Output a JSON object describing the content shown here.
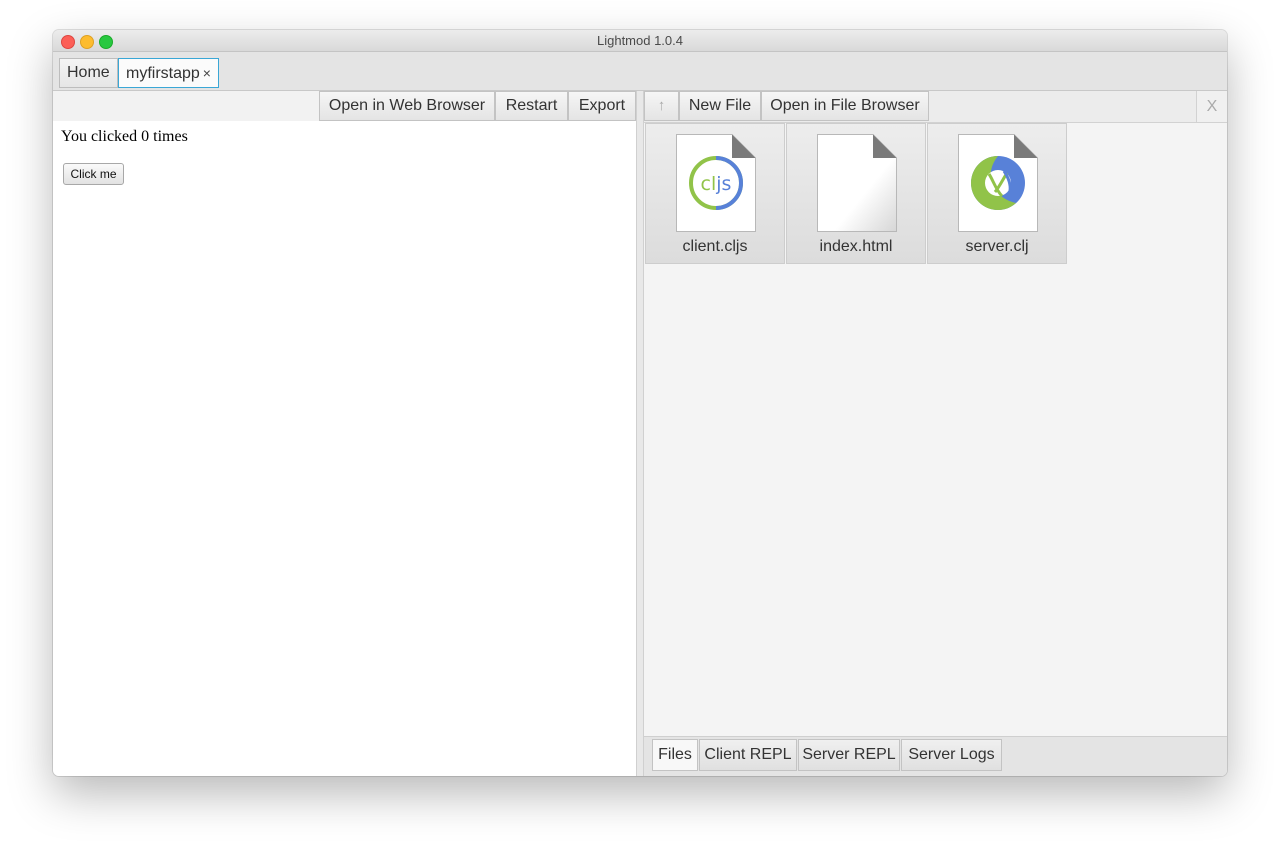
{
  "window": {
    "title": "Lightmod 1.0.4"
  },
  "tabs": [
    {
      "label": "Home"
    },
    {
      "label": "myfirstapp",
      "close": "×"
    }
  ],
  "left_toolbar": {
    "open_web_label": "Open in Web Browser",
    "restart_label": "Restart",
    "export_label": "Export"
  },
  "webview": {
    "status_text": "You clicked 0 times",
    "button_label": "Click me"
  },
  "right_toolbar": {
    "up_label": "↑",
    "new_file_label": "New File",
    "open_file_browser_label": "Open in File Browser",
    "close_label": "X"
  },
  "files": [
    {
      "name": "client.cljs",
      "icon": "cljs-file-icon",
      "badge_text": "cljs"
    },
    {
      "name": "index.html",
      "icon": "blank-file-icon"
    },
    {
      "name": "server.clj",
      "icon": "clojure-file-icon"
    }
  ],
  "bottom_tabs": [
    {
      "label": "Files"
    },
    {
      "label": "Client REPL"
    },
    {
      "label": "Server REPL"
    },
    {
      "label": "Server Logs"
    }
  ],
  "colors": {
    "tab_active_border": "#3aa7d6",
    "cljs_green": "#91c349",
    "cljs_blue": "#5881d8"
  }
}
